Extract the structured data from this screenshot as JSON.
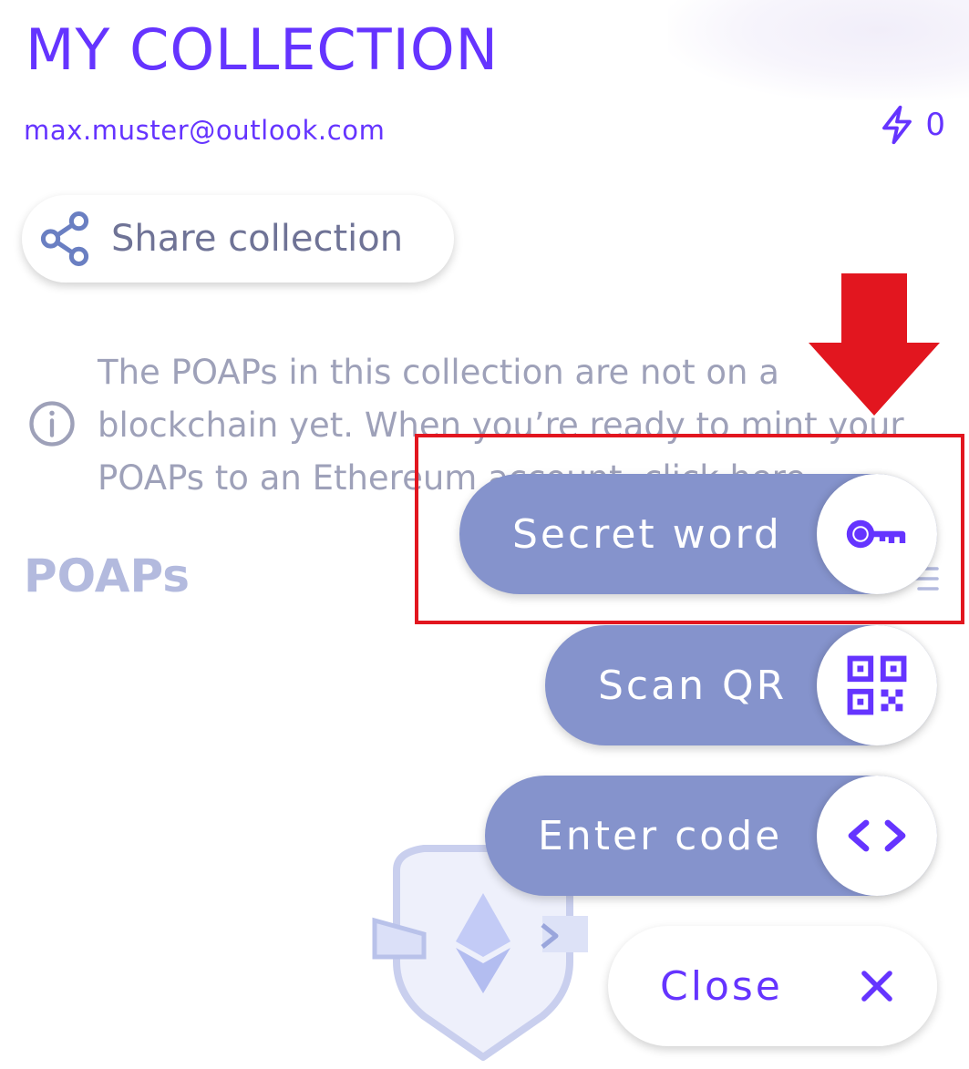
{
  "header": {
    "title": "MY COLLECTION",
    "email": "max.muster@outlook.com",
    "energy_count": "0"
  },
  "share": {
    "label": "Share collection"
  },
  "info": {
    "text_before": "The POAPs in this collection are not on a blockchain yet. When you’re ready to mint your POAPs to an Ethereum account, ",
    "link": "click here",
    "text_after": "."
  },
  "poaps": {
    "heading": "POAPs"
  },
  "fab_menu": {
    "secret_word": "Secret word",
    "scan_qr": "Scan QR",
    "enter_code": "Enter code",
    "close": "Close"
  },
  "colors": {
    "accent": "#6534ff",
    "pill": "#8593cc",
    "text_muted": "#6a6f94",
    "annotation": "#e2161f"
  },
  "icons": {
    "energy": "lightning-icon",
    "share": "share-icon",
    "info": "info-icon",
    "secret_word": "key-icon",
    "scan_qr": "qr-code-icon",
    "enter_code": "code-brackets-icon",
    "close": "close-icon"
  }
}
